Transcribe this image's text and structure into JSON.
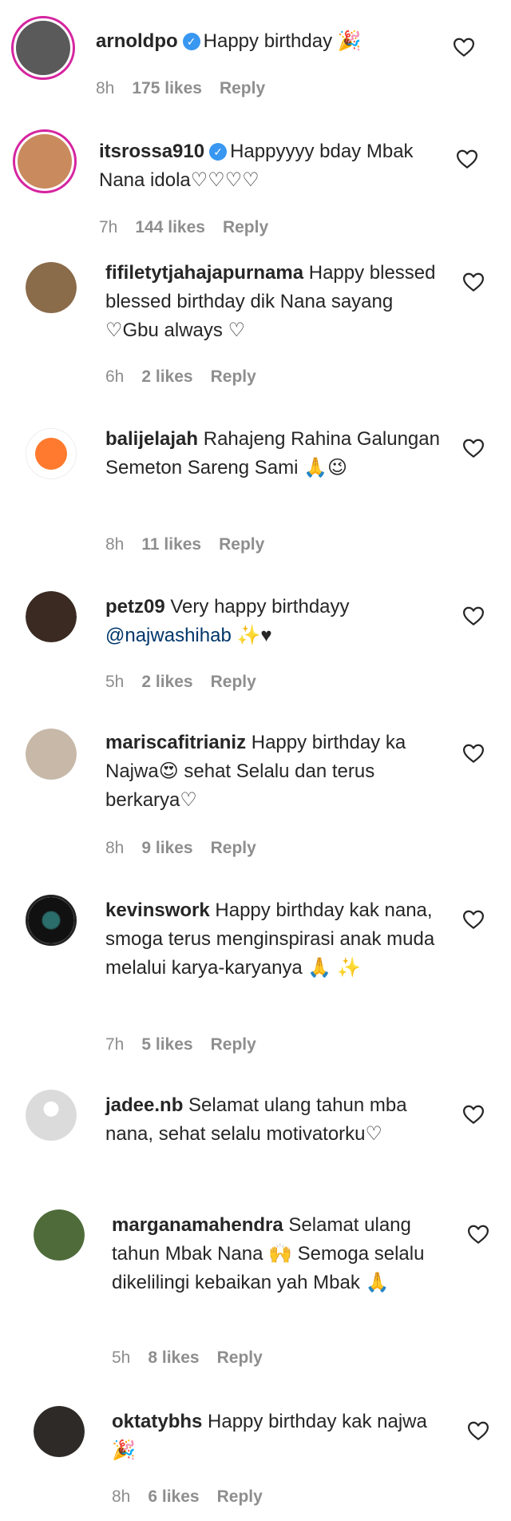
{
  "comments": [
    {
      "username": "arnoldpo",
      "verified": true,
      "text": "Happy birthday 🎉",
      "time": "8h",
      "likes": "175 likes",
      "reply": "Reply",
      "avatar_color": "#5a5a5a",
      "story_ring": true
    },
    {
      "username": "itsrossa910",
      "verified": true,
      "text": "Happyyyy bday Mbak Nana idola♡♡♡♡",
      "time": "7h",
      "likes": "144 likes",
      "reply": "Reply",
      "avatar_color": "#c98a5e",
      "story_ring": true
    },
    {
      "username": "fifiletytjahajapurnama",
      "verified": false,
      "text": "Happy blessed blessed birthday dik Nana sayang ♡Gbu always ♡",
      "time": "6h",
      "likes": "2 likes",
      "reply": "Reply",
      "avatar_color": "#8a6b4a"
    },
    {
      "username": "balijelajah",
      "verified": false,
      "text": "Rahajeng Rahina Galungan Semeton Sareng Sami 🙏😉",
      "time": "8h",
      "likes": "11 likes",
      "reply": "Reply",
      "avatar_color": "#ff7a2e"
    },
    {
      "username": "petz09",
      "verified": false,
      "text": "Very happy birthdayy",
      "mention": "@najwashihab",
      "text_after": " ✨♥",
      "time": "5h",
      "likes": "2 likes",
      "reply": "Reply",
      "avatar_color": "#3a2a22"
    },
    {
      "username": "mariscafitrianiz",
      "verified": false,
      "text": "Happy birthday ka Najwa😍 sehat Selalu dan terus berkarya♡",
      "time": "8h",
      "likes": "9 likes",
      "reply": "Reply",
      "avatar_color": "#c7b8a8"
    },
    {
      "username": "kevinswork",
      "verified": false,
      "text": "Happy birthday kak nana, smoga terus menginspirasi anak muda melalui karya-karyanya 🙏 ✨",
      "time": "7h",
      "likes": "5 likes",
      "reply": "Reply",
      "avatar_color": "#111111"
    },
    {
      "username": "jadee.nb",
      "verified": false,
      "text": "Selamat ulang tahun mba nana, sehat selalu motivatorku♡",
      "avatar_color": "#dbdbdb"
    },
    {
      "username": "marganamahendra",
      "verified": false,
      "text": "Selamat ulang tahun Mbak Nana 🙌 Semoga selalu dikelilingi kebaikan yah Mbak 🙏",
      "time": "5h",
      "likes": "8 likes",
      "reply": "Reply",
      "avatar_color": "#4f6b3a"
    },
    {
      "username": "oktatybhs",
      "verified": false,
      "text": "Happy birthday kak najwa🎉",
      "time": "8h",
      "likes": "6 likes",
      "reply": "Reply",
      "avatar_color": "#2e2a28"
    }
  ]
}
